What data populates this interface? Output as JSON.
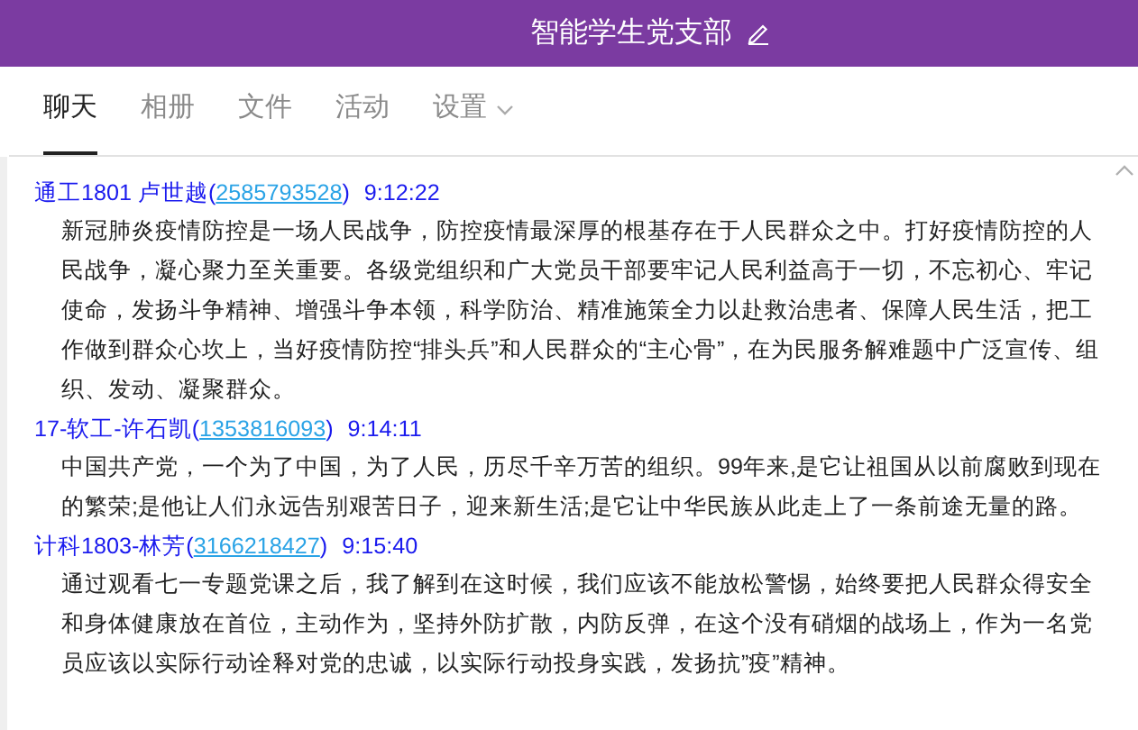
{
  "window": {
    "title": "智能学生党支部"
  },
  "tabs": [
    {
      "label": "聊天",
      "selected": true,
      "dropdown": false
    },
    {
      "label": "相册",
      "selected": false,
      "dropdown": false
    },
    {
      "label": "文件",
      "selected": false,
      "dropdown": false
    },
    {
      "label": "活动",
      "selected": false,
      "dropdown": false
    },
    {
      "label": "设置",
      "selected": false,
      "dropdown": true
    }
  ],
  "messages": [
    {
      "sender": "通工1801 卢世越(",
      "qq": "2585793528",
      "bracket": ")",
      "time": "9:12:22",
      "text": "新冠肺炎疫情防控是一场人民战争，防控疫情最深厚的根基存在于人民群众之中。打好疫情防控的人民战争，凝心聚力至关重要。各级党组织和广大党员干部要牢记人民利益高于一切，不忘初心、牢记使命，发扬斗争精神、增强斗争本领，科学防治、精准施策全力以赴救治患者、保障人民生活，把工作做到群众心坎上，当好疫情防控“排头兵”和人民群众的“主心骨”，在为民服务解难题中广泛宣传、组织、发动、凝聚群众。"
    },
    {
      "sender": "17-软工-许石凯(",
      "qq": "1353816093",
      "bracket": ")",
      "time": "9:14:11",
      "text": "中国共产党，一个为了中国，为了人民，历尽千辛万苦的组织。99年来,是它让祖国从以前腐败到现在的繁荣;是他让人们永远告别艰苦日子，迎来新生活;是它让中华民族从此走上了一条前途无量的路。"
    },
    {
      "sender": "计科1803-林芳(",
      "qq": "3166218427",
      "bracket": ")",
      "time": "9:15:40",
      "text": "通过观看七一专题党课之后，我了解到在这时候，我们应该不能放松警惕，始终要把人民群众得安全和身体健康放在首位，主动作为，坚持外防扩散，内防反弹，在这个没有硝烟的战场上，作为一名党员应该以实际行动诠释对党的忠诚，以实际行动投身实践，发扬抗”疫”精神。"
    }
  ]
}
